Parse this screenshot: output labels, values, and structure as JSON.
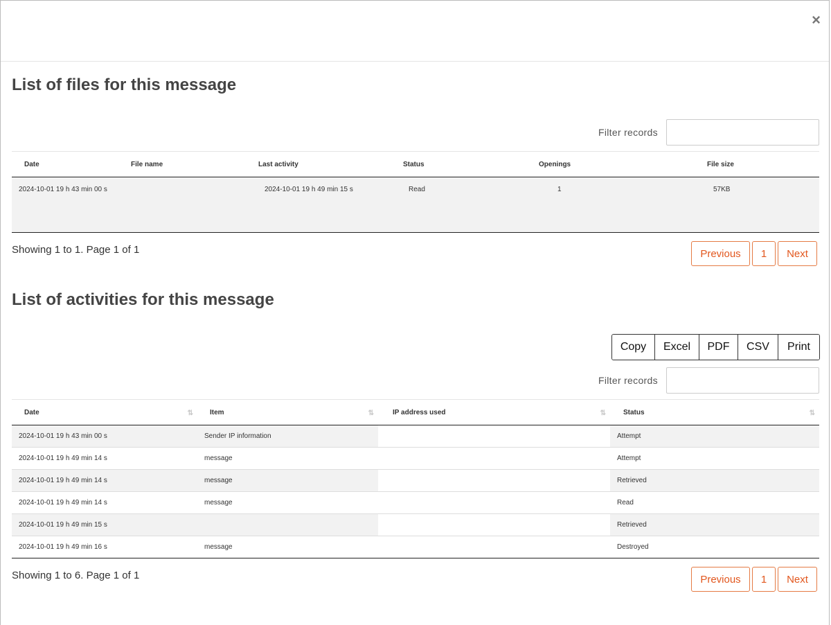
{
  "close_label": "×",
  "files_section": {
    "title": "List of files for this message",
    "filter_label": "Filter records",
    "columns": [
      "Date",
      "File name",
      "Last activity",
      "Status",
      "Openings",
      "File size"
    ],
    "rows": [
      [
        "2024-10-01 19 h 43 min 00 s",
        "",
        "2024-10-01 19 h 49 min 15 s",
        "Read",
        "1",
        "57KB"
      ]
    ],
    "info": "Showing 1 to 1. Page 1 of 1",
    "pager": {
      "previous": "Previous",
      "page": "1",
      "next": "Next"
    }
  },
  "activities_section": {
    "title": "List of activities for this message",
    "export_buttons": [
      "Copy",
      "Excel",
      "PDF",
      "CSV",
      "Print"
    ],
    "filter_label": "Filter records",
    "columns": [
      "Date",
      "Item",
      "IP address used",
      "Status"
    ],
    "rows": [
      [
        "2024-10-01 19 h 43 min 00 s",
        "Sender IP information",
        "",
        "Attempt"
      ],
      [
        "2024-10-01 19 h 49 min 14 s",
        "message",
        "",
        "Attempt"
      ],
      [
        "2024-10-01 19 h 49 min 14 s",
        "message",
        "",
        "Retrieved"
      ],
      [
        "2024-10-01 19 h 49 min 14 s",
        "message",
        "",
        "Read"
      ],
      [
        "2024-10-01 19 h 49 min 15 s",
        "",
        "",
        "Retrieved"
      ],
      [
        "2024-10-01 19 h 49 min 16 s",
        "message",
        "",
        "Destroyed"
      ]
    ],
    "info": "Showing 1 to 6. Page 1 of 1",
    "pager": {
      "previous": "Previous",
      "page": "1",
      "next": "Next"
    }
  },
  "colors": {
    "accent": "#e2571e",
    "row_stripe": "#f2f2f2"
  }
}
